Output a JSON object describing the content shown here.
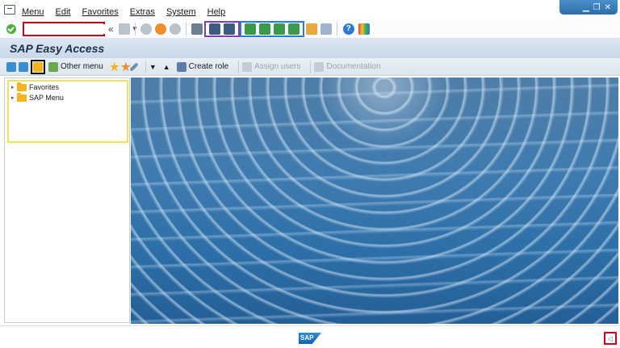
{
  "menubar": {
    "items": [
      {
        "label": "Menu",
        "name": "menu-menu"
      },
      {
        "label": "Edit",
        "name": "menu-edit"
      },
      {
        "label": "Favorites",
        "name": "menu-favorites"
      },
      {
        "label": "Extras",
        "name": "menu-extras"
      },
      {
        "label": "System",
        "name": "menu-system"
      },
      {
        "label": "Help",
        "name": "menu-help"
      }
    ]
  },
  "toolbar": {
    "command_field_value": "",
    "icons": [
      "ok-icon",
      "back-icon",
      "exit-icon",
      "cancel-icon",
      "print-icon",
      "find-icon",
      "find-next-icon",
      "first-page-icon",
      "prev-page-icon",
      "next-page-icon",
      "last-page-icon",
      "new-session-icon",
      "shortcut-icon",
      "help-icon",
      "customize-icon"
    ]
  },
  "title": "SAP Easy Access",
  "apptoolbar": {
    "other_menu": "Other menu",
    "create_role": "Create role",
    "assign_users": "Assign users",
    "documentation": "Documentation"
  },
  "tree": {
    "items": [
      {
        "label": "Favorites"
      },
      {
        "label": "SAP Menu"
      }
    ]
  },
  "footer": {
    "logo_text": "SAP"
  },
  "colors": {
    "highlight_red": "#d0021b",
    "highlight_purple": "#7b3fb4",
    "highlight_blue": "#2b7bd6",
    "highlight_yellow": "#f2e25a",
    "title_bar": "#c8d8e8"
  }
}
